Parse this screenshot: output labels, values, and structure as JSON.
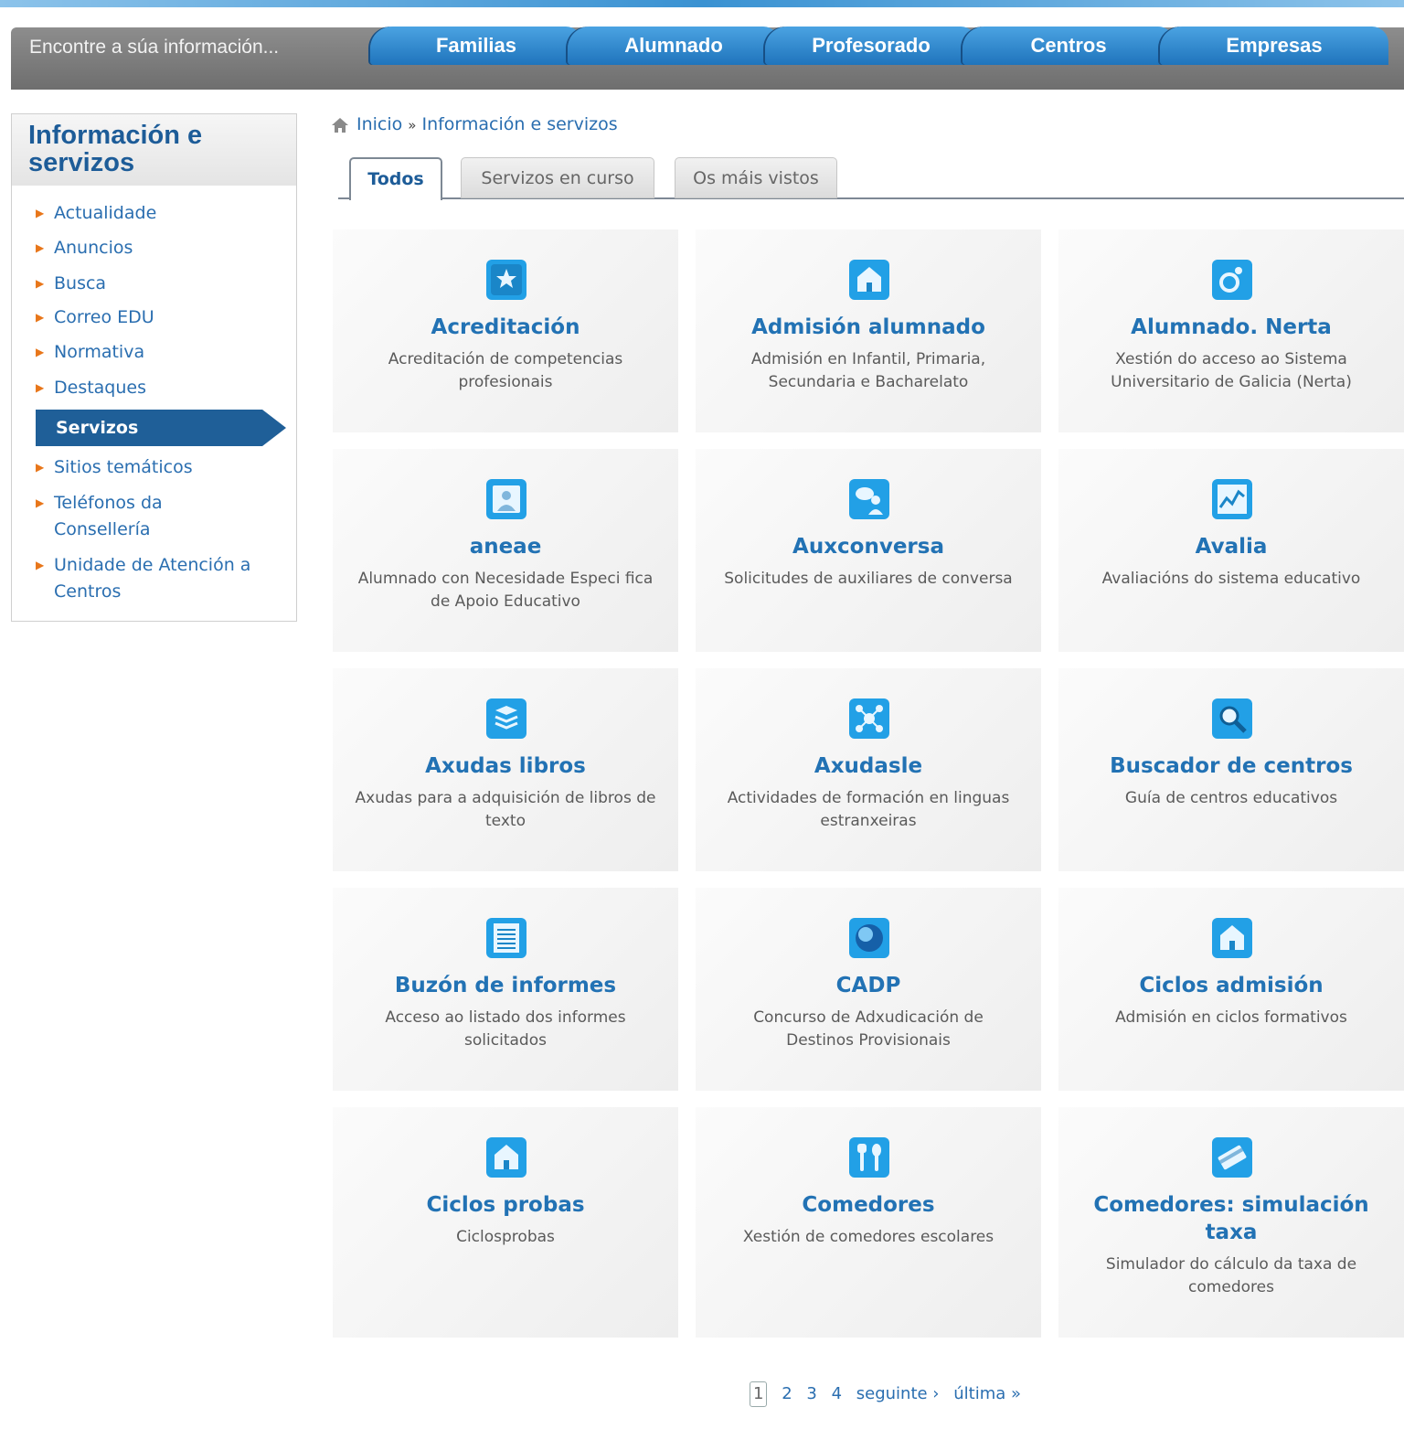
{
  "header": {
    "search_placeholder": "Encontre a súa información...",
    "nav": [
      "Familias",
      "Alumnado",
      "Profesorado",
      "Centros",
      "Empresas"
    ]
  },
  "sidebar": {
    "title": "Información e servizos",
    "items": [
      {
        "label": "Actualidade"
      },
      {
        "label": "Anuncios"
      },
      {
        "label": "Busca"
      },
      {
        "label": "Correo EDU"
      },
      {
        "label": "Normativa"
      },
      {
        "label": "Destaques"
      },
      {
        "label": "Servizos",
        "active": true
      },
      {
        "label": "Sitios temáticos"
      },
      {
        "label": "Teléfonos da Consellería"
      },
      {
        "label": "Unidade de Atención a Centros"
      }
    ]
  },
  "breadcrumb": {
    "home": "Inicio",
    "separator": "»",
    "current": "Información e servizos"
  },
  "tabs": [
    "Todos",
    "Servizos en curso",
    "Os máis vistos"
  ],
  "active_tab": "Todos",
  "cards": [
    {
      "title": "Acreditación",
      "desc": "Acreditación de competencias profesionais",
      "icon": "star-icon"
    },
    {
      "title": "Admisión alumnado",
      "desc": "Admisión en Infantil, Primaria, Secundaria e Bacharelato",
      "icon": "building-icon"
    },
    {
      "title": "Alumnado. Nerta",
      "desc": "Xestión do acceso ao Sistema Universitario de Galicia (Nerta)",
      "icon": "ring-icon"
    },
    {
      "title": "aneae",
      "desc": "Alumnado con Necesidade Especi fica de Apoio Educativo",
      "icon": "person-icon"
    },
    {
      "title": "Auxconversa",
      "desc": "Solicitudes de auxiliares de conversa",
      "icon": "chat-icon"
    },
    {
      "title": "Avalia",
      "desc": "Avaliacións do sistema educativo",
      "icon": "chart-icon"
    },
    {
      "title": "Axudas libros",
      "desc": "Axudas para a adquisición de libros de texto",
      "icon": "books-icon"
    },
    {
      "title": "Axudasle",
      "desc": "Actividades de formación en linguas estranxeiras",
      "icon": "network-icon"
    },
    {
      "title": "Buscador de centros",
      "desc": "Guía de centros educativos",
      "icon": "magnifier-icon"
    },
    {
      "title": "Buzón de informes",
      "desc": "Acceso ao listado dos informes solicitados",
      "icon": "document-icon"
    },
    {
      "title": "CADP",
      "desc": "Concurso de Adxudicación de Destinos Provisionais",
      "icon": "globe-icon"
    },
    {
      "title": "Ciclos admisión",
      "desc": "Admisión en ciclos formativos",
      "icon": "building-icon"
    },
    {
      "title": "Ciclos probas",
      "desc": "Ciclosprobas",
      "icon": "building-icon"
    },
    {
      "title": "Comedores",
      "desc": "Xestión de comedores escolares",
      "icon": "cutlery-icon"
    },
    {
      "title": "Comedores: simulación taxa",
      "desc": "Simulador do cálculo da taxa de comedores",
      "icon": "card-icon"
    }
  ],
  "pager": {
    "current": "1",
    "pages": [
      "2",
      "3",
      "4"
    ],
    "next": "seguinte ›",
    "last": "última »"
  },
  "colors": {
    "nav_blue": "#2a83cc",
    "title_blue": "#1d5c98",
    "accent_orange": "#e8761a",
    "active_item": "#1f5f98"
  }
}
